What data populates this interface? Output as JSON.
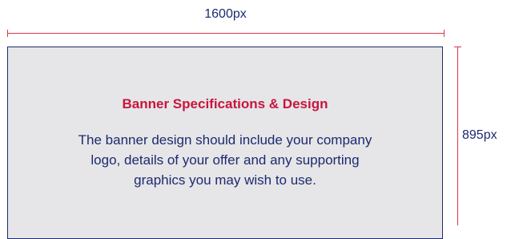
{
  "dimensions": {
    "width_label": "1600px",
    "height_label": "895px"
  },
  "banner": {
    "title": "Banner Specifications & Design",
    "body_lines": [
      "The banner design should include your company",
      "logo, details of your offer and any supporting",
      "graphics you may wish to use."
    ]
  },
  "colors": {
    "accent": "#d8374c",
    "title": "#c8153d",
    "text": "#1e2a6e",
    "banner_fill": "#e6e6e8"
  }
}
